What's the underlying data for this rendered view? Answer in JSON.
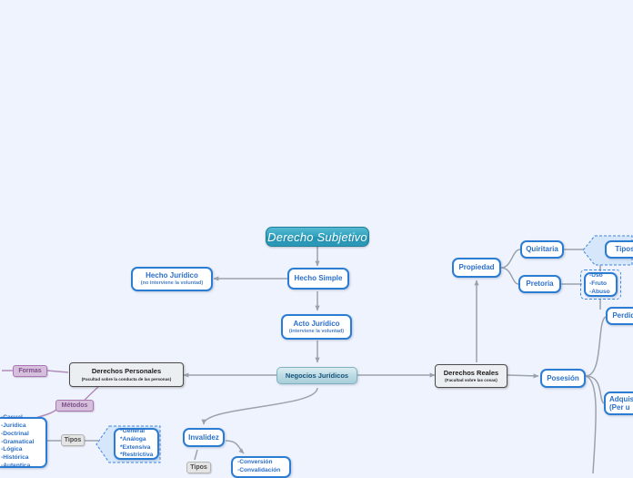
{
  "canvas": {
    "background": "#eff3fd",
    "accent_teal": "#2f9fbc",
    "accent_blue": "#2b7cd3",
    "accent_purple": "#a977b4",
    "accent_grey": "#4c4c4c"
  },
  "root": {
    "label": "Derecho Subjetivo"
  },
  "nodes": {
    "hecho_simple": {
      "label": "Hecho Simple"
    },
    "hecho_juridico": {
      "label": "Hecho Jurídico",
      "sub": "(no interviene la voluntad)"
    },
    "acto_juridico": {
      "label": "Acto Jurídico",
      "sub": "(interviene la voluntad)"
    },
    "negocios_juridicos": {
      "label": "Negocios Jurídicos"
    },
    "derechos_personales": {
      "label": "Derechos Personales",
      "sub": "(Facultad sobre la conducta de las personas)"
    },
    "derechos_reales": {
      "label": "Derechos Reales",
      "sub": "(Facultad sobre las cosas)"
    },
    "propiedad": {
      "label": "Propiedad"
    },
    "quiritaria": {
      "label": "Quiritaria"
    },
    "pretoria": {
      "label": "Pretoria"
    },
    "tipos_propiedad": {
      "label": "Tipos"
    },
    "uso_fruto_abuso": {
      "lines": [
        "-Uso",
        "-Fruto",
        "-Abuso"
      ]
    },
    "posesion": {
      "label": "Posesión"
    },
    "perdida": {
      "label": "Perdida"
    },
    "adquisicion": {
      "label": "Adquis",
      "sub": "(Per u"
    },
    "invalidez": {
      "label": "Invalidez"
    },
    "tipos_invalidez": {
      "label": "Tipos"
    },
    "conversion_convalidacion": {
      "lines": [
        "-Conversión",
        "-Convalidación"
      ]
    },
    "formas": {
      "label": "Formas"
    },
    "metodos": {
      "label": "Métodos"
    },
    "tipos_metodos": {
      "label": "Tipos"
    },
    "metodos_lista": {
      "lines": [
        "-Casual",
        "-Jurídica",
        "-Doctrinal",
        "-Gramatical",
        "-Lógica",
        "-Histórica",
        "-Autentica"
      ]
    },
    "interpretacion_lista": {
      "lines": [
        "*General",
        "*Análoga",
        "*Extensiva",
        "*Restrictiva"
      ]
    }
  }
}
